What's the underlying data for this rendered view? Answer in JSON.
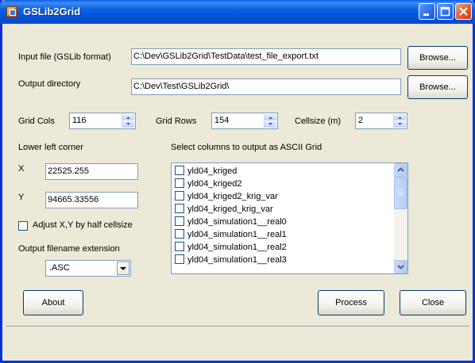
{
  "window": {
    "title": "GSLib2Grid"
  },
  "input_file": {
    "label": "Input file (GSLib format)",
    "value": "C:\\Dev\\GSLib2Grid\\TestData\\test_file_export.txt",
    "browse": "Browse..."
  },
  "output_dir": {
    "label": "Output directory",
    "value": "C:\\Dev\\Test\\GSLib2Grid\\",
    "browse": "Browse..."
  },
  "grid": {
    "cols_label": "Grid Cols",
    "cols": "116",
    "rows_label": "Grid Rows",
    "rows": "154",
    "cellsize_label": "Cellsize (m)",
    "cellsize": "2"
  },
  "lower_left": {
    "heading": "Lower left corner",
    "x_label": "X",
    "x": "22525.255",
    "y_label": "Y",
    "y": "94665.33556",
    "adjust_label": "Adjust X,Y by half cellsize"
  },
  "extension": {
    "label": "Output filename extension",
    "value": ".ASC"
  },
  "columns": {
    "heading": "Select columns to output as ASCII Grid",
    "items": [
      "yld04_kriged",
      "yld04_kriged2",
      "yld04_kriged2_krig_var",
      "yld04_kriged_krig_var",
      "yld04_simulation1__real0",
      "yld04_simulation1__real1",
      "yld04_simulation1__real2",
      "yld04_simulation1__real3"
    ]
  },
  "buttons": {
    "about": "About",
    "process": "Process",
    "close": "Close"
  },
  "icons": {
    "app": "app-grid-icon",
    "minimize": "minimize-icon",
    "maximize": "maximize-icon",
    "close": "close-icon"
  },
  "colors": {
    "titlebar": "#0b5fe3",
    "form_bg": "#ece9d8",
    "close_button": "#e0592d"
  }
}
